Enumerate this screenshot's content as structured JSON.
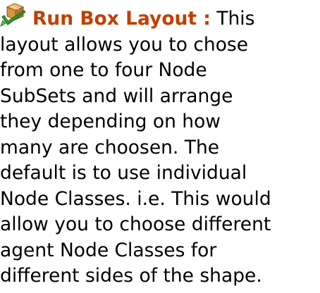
{
  "entry": {
    "icon": "run-box-layout-icon",
    "term": "Run Box Layout :",
    "term_color": "#C04000",
    "lines": [
      "This",
      "layout allows you to chose",
      "from one to four Node",
      "SubSets and will arrange",
      "they depending on how",
      "many are choosen. The",
      "default is to use individual",
      "Node Classes. i.e. This would",
      "allow you to choose different",
      "agent Node Classes for",
      "different sides of the shape."
    ]
  }
}
